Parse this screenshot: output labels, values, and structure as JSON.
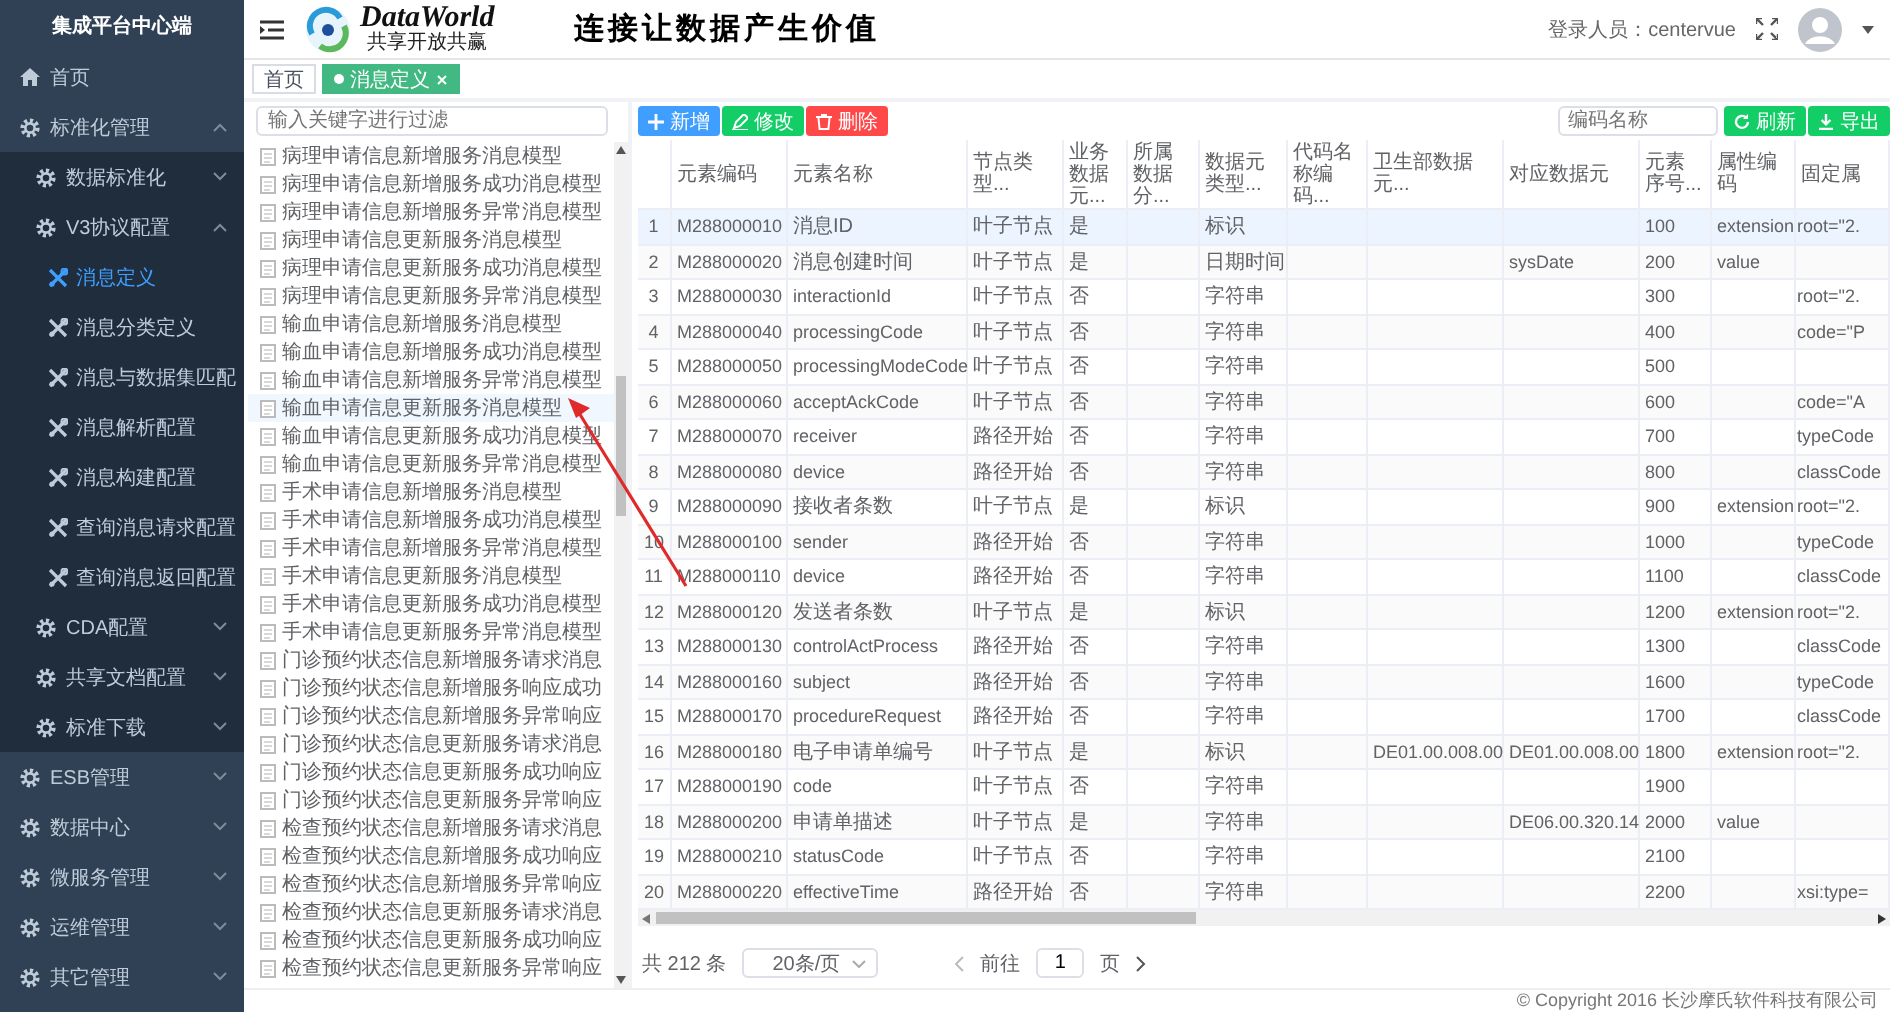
{
  "sidebar": {
    "title": "集成平台中心端",
    "items": [
      {
        "label": "首页",
        "selected": false
      },
      {
        "label": "标准化管理",
        "selected": false,
        "expanded": true,
        "children": [
          {
            "label": "数据标准化",
            "selected": false,
            "expanded": false
          },
          {
            "label": "V3协议配置",
            "selected": false,
            "expanded": true,
            "children": [
              {
                "label": "消息定义",
                "selected": true
              },
              {
                "label": "消息分类定义",
                "selected": false
              },
              {
                "label": "消息与数据集匹配",
                "selected": false
              },
              {
                "label": "消息解析配置",
                "selected": false
              },
              {
                "label": "消息构建配置",
                "selected": false
              },
              {
                "label": "查询消息请求配置",
                "selected": false
              },
              {
                "label": "查询消息返回配置",
                "selected": false
              }
            ]
          },
          {
            "label": "CDA配置",
            "selected": false,
            "expanded": false
          },
          {
            "label": "共享文档配置",
            "selected": false,
            "expanded": false
          },
          {
            "label": "标准下载",
            "selected": false,
            "expanded": false
          }
        ]
      },
      {
        "label": "ESB管理",
        "selected": false,
        "expanded": false
      },
      {
        "label": "数据中心",
        "selected": false,
        "expanded": false
      },
      {
        "label": "微服务管理",
        "selected": false,
        "expanded": false
      },
      {
        "label": "运维管理",
        "selected": false,
        "expanded": false
      },
      {
        "label": "其它管理",
        "selected": false,
        "expanded": false
      }
    ]
  },
  "header": {
    "logo_title": "DataWorld",
    "logo_subtitle": "共享开放共赢",
    "slogan": "连接让数据产生价值",
    "user_label": "登录人员：centervue"
  },
  "tabs": [
    {
      "label": "首页",
      "selected": false,
      "closable": false
    },
    {
      "label": "消息定义",
      "selected": true,
      "closable": true
    }
  ],
  "tree": {
    "placeholder": "输入关键字进行过滤",
    "items": [
      {
        "label": "病理申请信息新增服务消息模型",
        "selected": false
      },
      {
        "label": "病理申请信息新增服务成功消息模型",
        "selected": false
      },
      {
        "label": "病理申请信息新增服务异常消息模型",
        "selected": false
      },
      {
        "label": "病理申请信息更新服务消息模型",
        "selected": false
      },
      {
        "label": "病理申请信息更新服务成功消息模型",
        "selected": false
      },
      {
        "label": "病理申请信息更新服务异常消息模型",
        "selected": false
      },
      {
        "label": "输血申请信息新增服务消息模型",
        "selected": false
      },
      {
        "label": "输血申请信息新增服务成功消息模型",
        "selected": false
      },
      {
        "label": "输血申请信息新增服务异常消息模型",
        "selected": false
      },
      {
        "label": "输血申请信息更新服务消息模型",
        "selected": true
      },
      {
        "label": "输血申请信息更新服务成功消息模型",
        "selected": false
      },
      {
        "label": "输血申请信息更新服务异常消息模型",
        "selected": false
      },
      {
        "label": "手术申请信息新增服务消息模型",
        "selected": false
      },
      {
        "label": "手术申请信息新增服务成功消息模型",
        "selected": false
      },
      {
        "label": "手术申请信息新增服务异常消息模型",
        "selected": false
      },
      {
        "label": "手术申请信息更新服务消息模型",
        "selected": false
      },
      {
        "label": "手术申请信息更新服务成功消息模型",
        "selected": false
      },
      {
        "label": "手术申请信息更新服务异常消息模型",
        "selected": false
      },
      {
        "label": "门诊预约状态信息新增服务请求消息",
        "selected": false
      },
      {
        "label": "门诊预约状态信息新增服务响应成功",
        "selected": false
      },
      {
        "label": "门诊预约状态信息新增服务异常响应",
        "selected": false
      },
      {
        "label": "门诊预约状态信息更新服务请求消息",
        "selected": false
      },
      {
        "label": "门诊预约状态信息更新服务成功响应",
        "selected": false
      },
      {
        "label": "门诊预约状态信息更新服务异常响应",
        "selected": false
      },
      {
        "label": "检查预约状态信息新增服务请求消息",
        "selected": false
      },
      {
        "label": "检查预约状态信息新增服务成功响应",
        "selected": false
      },
      {
        "label": "检查预约状态信息新增服务异常响应",
        "selected": false
      },
      {
        "label": "检查预约状态信息更新服务请求消息",
        "selected": false
      },
      {
        "label": "检查预约状态信息更新服务成功响应",
        "selected": false
      },
      {
        "label": "检查预约状态信息更新服务异常响应",
        "selected": false
      }
    ]
  },
  "toolbar": {
    "buttons": [
      {
        "label": "新增",
        "kind": "add"
      },
      {
        "label": "修改",
        "kind": "edit"
      },
      {
        "label": "删除",
        "kind": "delete"
      }
    ],
    "search": {
      "placeholder": "编码名称"
    },
    "right_buttons": [
      {
        "label": "刷新",
        "kind": "refresh"
      },
      {
        "label": "导出",
        "kind": "export"
      }
    ]
  },
  "table": {
    "columns": [
      "元素编码",
      "元素名称",
      "节点类型...",
      "业务数据元...",
      "所属数据分...",
      "数据元类型...",
      "代码名称编码...",
      "卫生部数据元...",
      "对应数据元",
      "元素序号...",
      "属性编码",
      "固定属"
    ],
    "rows": [
      {
        "index": "1",
        "selected": true,
        "cells": [
          "M288000010",
          "消息ID",
          "叶子节点",
          "是",
          null,
          "标识",
          null,
          null,
          null,
          "100",
          "extension",
          "root=\"2."
        ]
      },
      {
        "index": "2",
        "selected": false,
        "cells": [
          "M288000020",
          "消息创建时间",
          "叶子节点",
          "是",
          null,
          "日期时间",
          null,
          null,
          "sysDate",
          "200",
          "value",
          null
        ]
      },
      {
        "index": "3",
        "selected": false,
        "cells": [
          "M288000030",
          "interactionId",
          "叶子节点",
          "否",
          null,
          "字符串",
          null,
          null,
          null,
          "300",
          null,
          "root=\"2."
        ]
      },
      {
        "index": "4",
        "selected": false,
        "cells": [
          "M288000040",
          "processingCode",
          "叶子节点",
          "否",
          null,
          "字符串",
          null,
          null,
          null,
          "400",
          null,
          "code=\"P"
        ]
      },
      {
        "index": "5",
        "selected": false,
        "cells": [
          "M288000050",
          "processingModeCode",
          "叶子节点",
          "否",
          null,
          "字符串",
          null,
          null,
          null,
          "500",
          null,
          null
        ]
      },
      {
        "index": "6",
        "selected": false,
        "cells": [
          "M288000060",
          "acceptAckCode",
          "叶子节点",
          "否",
          null,
          "字符串",
          null,
          null,
          null,
          "600",
          null,
          "code=\"A"
        ]
      },
      {
        "index": "7",
        "selected": false,
        "cells": [
          "M288000070",
          "receiver",
          "路径开始",
          "否",
          null,
          "字符串",
          null,
          null,
          null,
          "700",
          null,
          "typeCode"
        ]
      },
      {
        "index": "8",
        "selected": false,
        "cells": [
          "M288000080",
          "device",
          "路径开始",
          "否",
          null,
          "字符串",
          null,
          null,
          null,
          "800",
          null,
          "classCode"
        ]
      },
      {
        "index": "9",
        "selected": false,
        "cells": [
          "M288000090",
          "接收者条数",
          "叶子节点",
          "是",
          null,
          "标识",
          null,
          null,
          null,
          "900",
          "extension",
          "root=\"2."
        ]
      },
      {
        "index": "10",
        "selected": false,
        "cells": [
          "M288000100",
          "sender",
          "路径开始",
          "否",
          null,
          "字符串",
          null,
          null,
          null,
          "1000",
          null,
          "typeCode"
        ]
      },
      {
        "index": "11",
        "selected": false,
        "cells": [
          "M288000110",
          "device",
          "路径开始",
          "否",
          null,
          "字符串",
          null,
          null,
          null,
          "1100",
          null,
          "classCode"
        ]
      },
      {
        "index": "12",
        "selected": false,
        "cells": [
          "M288000120",
          "发送者条数",
          "叶子节点",
          "是",
          null,
          "标识",
          null,
          null,
          null,
          "1200",
          "extension",
          "root=\"2."
        ]
      },
      {
        "index": "13",
        "selected": false,
        "cells": [
          "M288000130",
          "controlActProcess",
          "路径开始",
          "否",
          null,
          "字符串",
          null,
          null,
          null,
          "1300",
          null,
          "classCode"
        ]
      },
      {
        "index": "14",
        "selected": false,
        "cells": [
          "M288000160",
          "subject",
          "路径开始",
          "否",
          null,
          "字符串",
          null,
          null,
          null,
          "1600",
          null,
          "typeCode"
        ]
      },
      {
        "index": "15",
        "selected": false,
        "cells": [
          "M288000170",
          "procedureRequest",
          "路径开始",
          "否",
          null,
          "字符串",
          null,
          null,
          null,
          "1700",
          null,
          "classCode"
        ]
      },
      {
        "index": "16",
        "selected": false,
        "cells": [
          "M288000180",
          "电子申请单编号",
          "叶子节点",
          "是",
          null,
          "标识",
          null,
          "DE01.00.008.00",
          "DE01.00.008.00",
          "1800",
          "extension",
          "root=\"2."
        ]
      },
      {
        "index": "17",
        "selected": false,
        "cells": [
          "M288000190",
          "code",
          "叶子节点",
          "否",
          null,
          "字符串",
          null,
          null,
          null,
          "1900",
          null,
          null
        ]
      },
      {
        "index": "18",
        "selected": false,
        "cells": [
          "M288000200",
          "申请单描述",
          "叶子节点",
          "是",
          null,
          "字符串",
          null,
          null,
          "DE06.00.320.14",
          "2000",
          "value",
          null
        ]
      },
      {
        "index": "19",
        "selected": false,
        "cells": [
          "M288000210",
          "statusCode",
          "叶子节点",
          "否",
          null,
          "字符串",
          null,
          null,
          null,
          "2100",
          null,
          null
        ]
      },
      {
        "index": "20",
        "selected": false,
        "cells": [
          "M288000220",
          "effectiveTime",
          "路径开始",
          "否",
          null,
          "字符串",
          null,
          null,
          null,
          "2200",
          null,
          "xsi:type="
        ]
      }
    ]
  },
  "pagination": {
    "total": "共 212 条",
    "page_size": "20条/页",
    "goto_label": "前往",
    "page": "1",
    "page_suffix": "页"
  },
  "footer": "© Copyright 2016 长沙摩氏软件科技有限公司"
}
